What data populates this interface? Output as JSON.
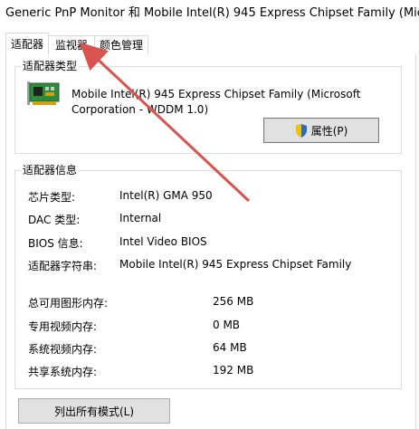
{
  "window": {
    "title": "Generic PnP Monitor 和 Mobile Intel(R) 945 Express Chipset Family (Mic..."
  },
  "tabs": [
    {
      "label": "适配器",
      "active": true
    },
    {
      "label": "监视器",
      "active": false
    },
    {
      "label": "颜色管理",
      "active": false
    }
  ],
  "adapter_type": {
    "group_label": "适配器类型",
    "name_line1": "Mobile Intel(R) 945 Express Chipset Family (Microsoft",
    "name_line2": "Corporation - WDDM 1.0)",
    "properties_button": "属性(P)",
    "icon": "graphics-card-icon"
  },
  "adapter_info": {
    "group_label": "适配器信息",
    "rows": [
      {
        "label": "芯片类型:",
        "value": "Intel(R) GMA 950"
      },
      {
        "label": "DAC 类型:",
        "value": "Internal"
      },
      {
        "label": "BIOS 信息:",
        "value": "Intel Video BIOS"
      },
      {
        "label": "适配器字符串:",
        "value": "Mobile Intel(R) 945 Express Chipset Family"
      }
    ],
    "memory_rows": [
      {
        "label": "总可用图形内存:",
        "value": "256 MB"
      },
      {
        "label": "专用视频内存:",
        "value": "0 MB"
      },
      {
        "label": "系统视频内存:",
        "value": "64 MB"
      },
      {
        "label": "共享系统内存:",
        "value": "192 MB"
      }
    ]
  },
  "buttons": {
    "list_all_modes": "列出所有模式(L)"
  },
  "colors": {
    "annotation_arrow": "#d9534f",
    "shield_blue": "#2b6cc4",
    "shield_yellow": "#f2c200"
  }
}
